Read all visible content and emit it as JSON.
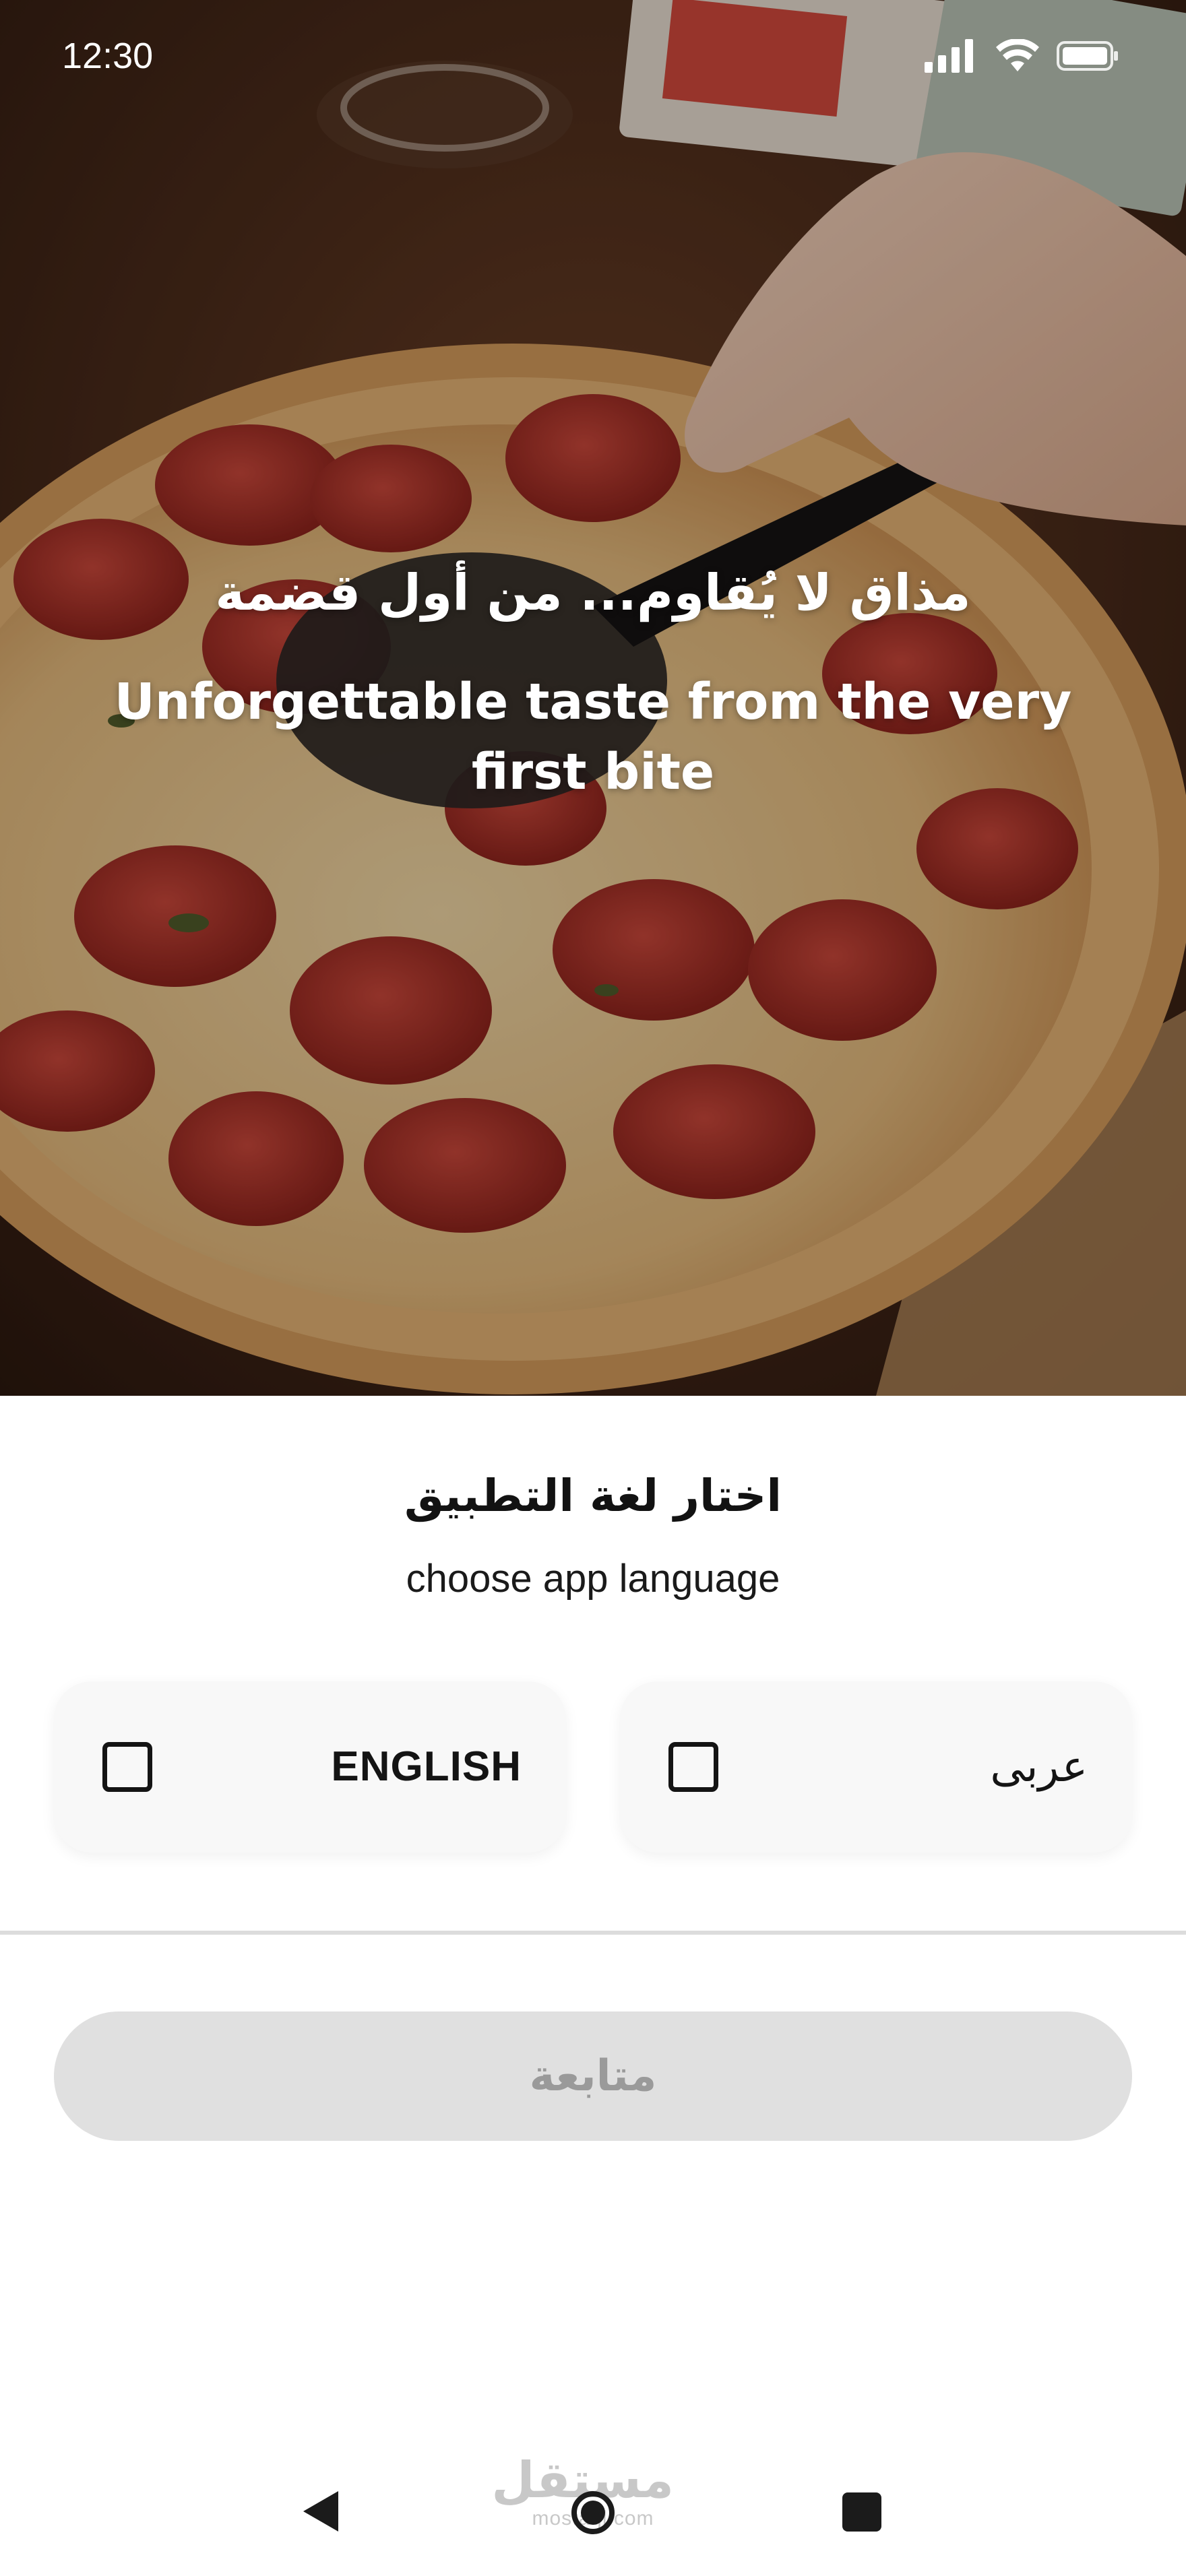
{
  "status_bar": {
    "time": "12:30"
  },
  "hero": {
    "tagline_ar": "مذاق لا يُقاوم... من أول قضمة",
    "tagline_en": "Unforgettable taste from the very first bite"
  },
  "language_sheet": {
    "title_ar": "اختار لغة التطبيق",
    "title_en": "choose app language",
    "options": [
      {
        "label": "ENGLISH",
        "checked": false
      },
      {
        "label": "عربى",
        "checked": false
      }
    ],
    "continue_label": "متابعة",
    "continue_enabled": false
  },
  "nav_bar": {
    "icons": [
      "back-icon",
      "home-icon",
      "recent-apps-icon"
    ]
  },
  "watermark": {
    "ar": "مستقل",
    "en": "mostaql.com"
  },
  "colors": {
    "sheet_background": "#ffffff",
    "card_background": "#f8f8f8",
    "button_disabled_background": "#e0e0e0",
    "button_disabled_text": "#9a9a9a",
    "text_primary": "#121212"
  }
}
